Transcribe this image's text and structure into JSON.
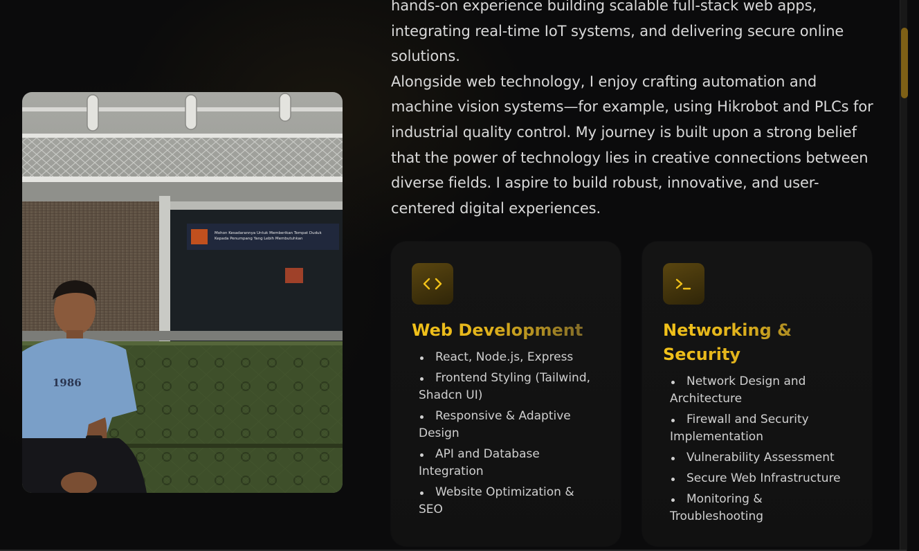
{
  "about": {
    "paragraph_1": "hands-on experience building scalable full-stack web apps, integrating real-time IoT systems, and delivering secure online solutions.",
    "paragraph_2": "Alongside web technology, I enjoy crafting automation and machine vision systems—for example, using Hikrobot and PLCs for industrial quality control. My journey is built upon a strong belief that the power of technology lies in creative connections between diverse fields. I aspire to build robust, innovative, and user-centered digital experiences."
  },
  "photo": {
    "shirt_print": "1986",
    "train_sign_line_1": "Mohon Kesadarannya Untuk Memberikan Tempat Duduk",
    "train_sign_line_2": "Kepada Penumpang Yang Lebih Membutuhkan"
  },
  "cards": [
    {
      "icon": "code-brackets-icon",
      "title": "Web Development",
      "items": [
        "React, Node.js, Express",
        "Frontend Styling (Tailwind, Shadcn UI)",
        "Responsive & Adaptive Design",
        "API and Database Integration",
        "Website Optimization & SEO"
      ]
    },
    {
      "icon": "terminal-icon",
      "title": "Networking & Security",
      "items": [
        "Network Design and Architecture",
        "Firewall and Security Implementation",
        "Vulnerability Assessment",
        "Secure Web Infrastructure",
        "Monitoring & Troubleshooting"
      ]
    }
  ],
  "colors": {
    "background": "#0b0b0c",
    "accent": "#f2c21a",
    "card_background": "#141414",
    "icon_box": "#4a3a0e",
    "text": "#d9d9d9",
    "scrollbar_thumb": "#7e6016"
  }
}
